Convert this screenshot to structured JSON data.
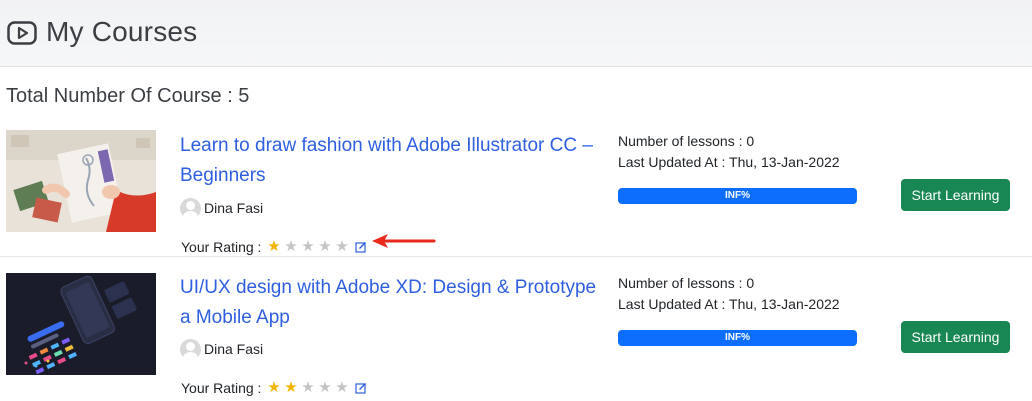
{
  "header": {
    "title": "My Courses",
    "icon": "play-circle-icon"
  },
  "summary": {
    "total_text": "Total Number Of Course : 5"
  },
  "courses": [
    {
      "title": "Learn to draw fashion with Adobe Illustrator CC – Beginners",
      "author": "Dina Fasi",
      "rating_label": "Your Rating :",
      "rating": 1,
      "rating_max": 5,
      "lessons_text": "Number of lessons : 0",
      "updated_text": "Last Updated At : Thu, 13-Jan-2022",
      "progress_text": "INF%",
      "button_label": "Start Learning"
    },
    {
      "title": "UI/UX design with Adobe XD: Design & Prototype a Mobile App",
      "author": "Dina Fasi",
      "rating_label": "Your Rating :",
      "rating": 2,
      "rating_max": 5,
      "lessons_text": "Number of lessons : 0",
      "updated_text": "Last Updated At : Thu, 13-Jan-2022",
      "progress_text": "INF%",
      "button_label": "Start Learning"
    }
  ],
  "colors": {
    "link": "#2f5fe0",
    "star_on": "#f0b400",
    "star_off": "#c4c4c4",
    "button": "#198754",
    "progress": "#0d6efd",
    "annotation_arrow": "#e8291c"
  }
}
